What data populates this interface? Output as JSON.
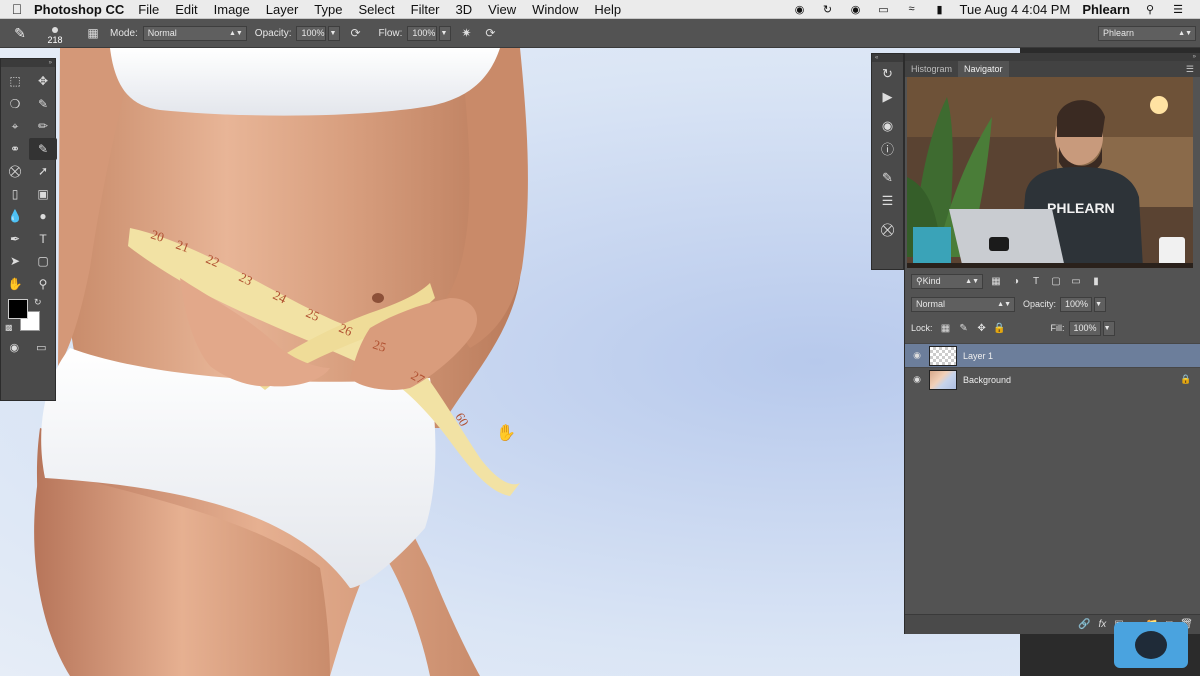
{
  "menubar": {
    "app_name": "Photoshop CC",
    "menus": [
      "File",
      "Edit",
      "Image",
      "Layer",
      "Type",
      "Select",
      "Filter",
      "3D",
      "View",
      "Window",
      "Help"
    ],
    "datetime": "Tue Aug 4  4:04 PM",
    "user": "Phlearn"
  },
  "options": {
    "brush_size": "218",
    "mode_label": "Mode:",
    "mode_value": "Normal",
    "opacity_label": "Opacity:",
    "opacity_value": "100%",
    "flow_label": "Flow:",
    "flow_value": "100%",
    "workspace": "Phlearn"
  },
  "tape_numbers": [
    "20",
    "21",
    "22",
    "23",
    "24",
    "25",
    "26",
    "27",
    "25",
    "60"
  ],
  "webcam": {
    "shirt_text": "PHLEARN"
  },
  "panels": {
    "tabs": [
      "Histogram",
      "Navigator"
    ],
    "active_tab": "Navigator",
    "filter_kind": "Kind",
    "blend_mode": "Normal",
    "opacity_label": "Opacity:",
    "opacity_value": "100%",
    "lock_label": "Lock:",
    "fill_label": "Fill:",
    "fill_value": "100%",
    "layers": [
      {
        "name": "Layer 1",
        "selected": true
      },
      {
        "name": "Background",
        "selected": false,
        "locked": true
      }
    ]
  },
  "colors": {
    "menubar_bg": "#ebebeb",
    "panel_bg": "#535353",
    "selected_layer": "#6c7e9b",
    "chat_button": "#4aa3df"
  }
}
